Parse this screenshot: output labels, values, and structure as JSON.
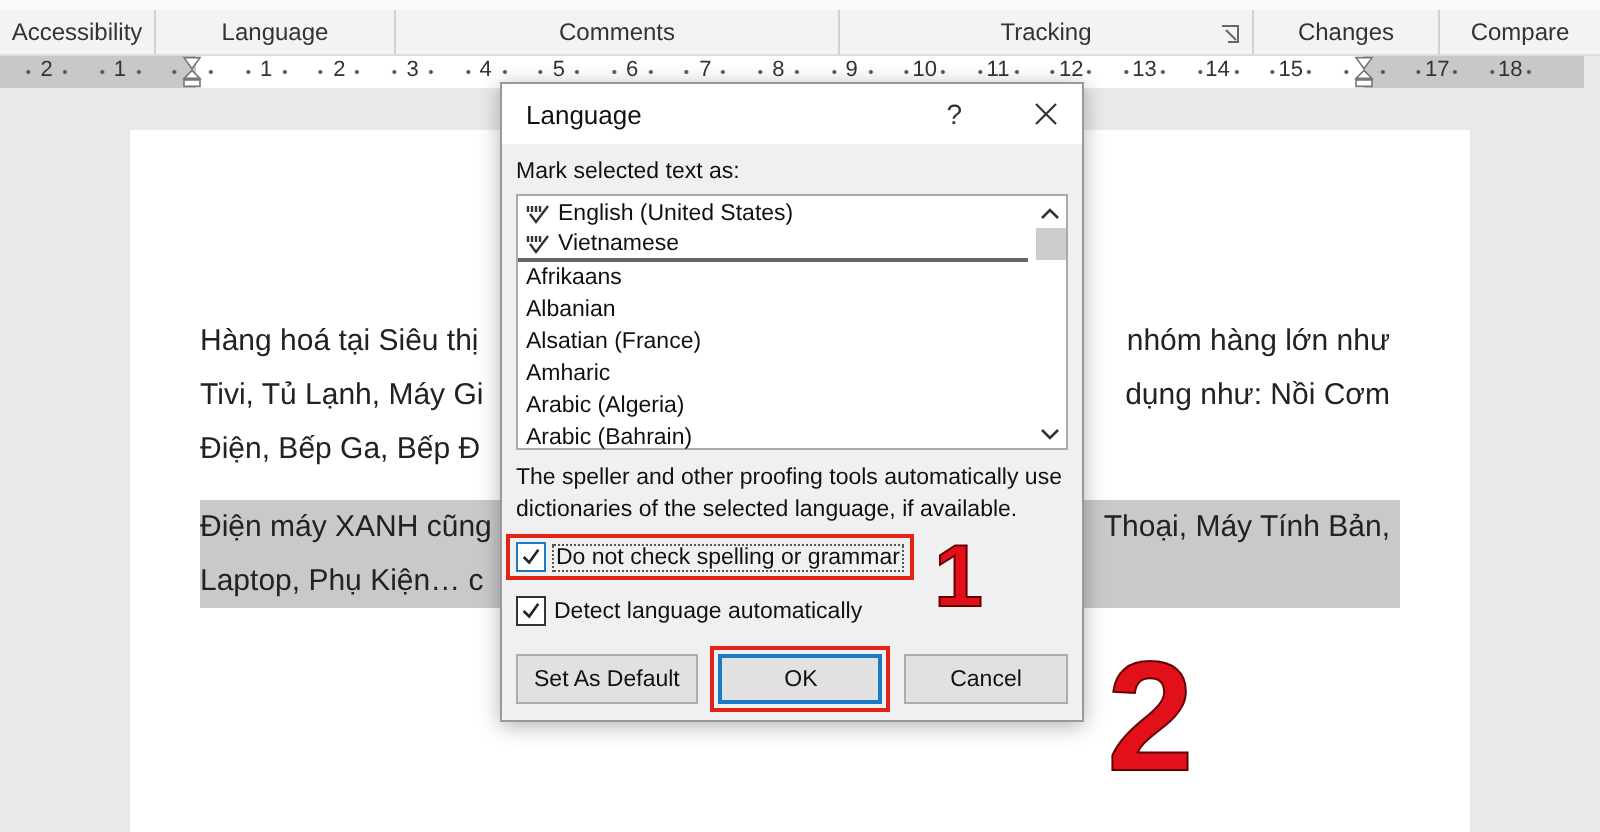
{
  "ribbon": {
    "groups": [
      {
        "label": "Accessibility",
        "launcher": false
      },
      {
        "label": "Language",
        "launcher": false
      },
      {
        "label": "Comments",
        "launcher": false
      },
      {
        "label": "Tracking",
        "launcher": true
      },
      {
        "label": "Changes",
        "launcher": false
      },
      {
        "label": "Compare",
        "launcher": false
      }
    ]
  },
  "ruler": {
    "items": [
      {
        "kind": "number",
        "label": "2"
      },
      {
        "kind": "number",
        "label": "1"
      },
      {
        "kind": "marker"
      },
      {
        "kind": "number",
        "label": "1"
      },
      {
        "kind": "number",
        "label": "2"
      },
      {
        "kind": "number",
        "label": "3"
      },
      {
        "kind": "number",
        "label": "4"
      },
      {
        "kind": "number",
        "label": "5"
      },
      {
        "kind": "number",
        "label": "6"
      },
      {
        "kind": "number",
        "label": "7"
      },
      {
        "kind": "number",
        "label": "8"
      },
      {
        "kind": "number",
        "label": "9"
      },
      {
        "kind": "number",
        "label": "10"
      },
      {
        "kind": "number",
        "label": "11"
      },
      {
        "kind": "number",
        "label": "12"
      },
      {
        "kind": "number",
        "label": "13"
      },
      {
        "kind": "number",
        "label": "14"
      },
      {
        "kind": "number",
        "label": "15"
      },
      {
        "kind": "marker"
      },
      {
        "kind": "number",
        "label": "17"
      },
      {
        "kind": "number",
        "label": "18"
      }
    ]
  },
  "document": {
    "paragraphs": [
      {
        "highlighted": false,
        "lines": [
          {
            "left": "Hàng hoá tại Siêu thị",
            "right": "nhóm hàng lớn như"
          },
          {
            "left": "Tivi, Tủ Lạnh, Máy Gi",
            "right": "dụng như: Nồi Cơm"
          },
          {
            "left": "Điện, Bếp Ga, Bếp Đ"
          }
        ]
      },
      {
        "highlighted": true,
        "lines": [
          {
            "left": "Điện máy XANH cũng",
            "right": "Thoại, Máy Tính Bản,"
          },
          {
            "left": "Laptop, Phụ Kiện… c"
          }
        ]
      }
    ]
  },
  "dialog": {
    "title": "Language",
    "help": "?",
    "list_label": "Mark selected text as:",
    "languages": [
      {
        "kind": "proofed",
        "label": "English (United States)"
      },
      {
        "kind": "proofed",
        "label": "Vietnamese"
      },
      {
        "kind": "plain",
        "label": "Afrikaans"
      },
      {
        "kind": "plain",
        "label": "Albanian"
      },
      {
        "kind": "plain",
        "label": "Alsatian (France)"
      },
      {
        "kind": "plain",
        "label": "Amharic"
      },
      {
        "kind": "plain",
        "label": "Arabic (Algeria)"
      },
      {
        "kind": "plain",
        "label": "Arabic (Bahrain)"
      }
    ],
    "description": "The speller and other proofing tools automatically use dictionaries of the selected language, if available.",
    "options": [
      {
        "label": "Do not check spelling or grammar",
        "checked": true,
        "annotated": true,
        "callout": "1"
      },
      {
        "label": "Detect language automatically",
        "checked": true,
        "annotated": false
      }
    ],
    "buttons": [
      {
        "label": "Set As Default",
        "default": false,
        "annotated": false
      },
      {
        "label": "OK",
        "default": true,
        "annotated": true,
        "callout": "2"
      },
      {
        "label": "Cancel",
        "default": false,
        "annotated": false
      }
    ]
  }
}
